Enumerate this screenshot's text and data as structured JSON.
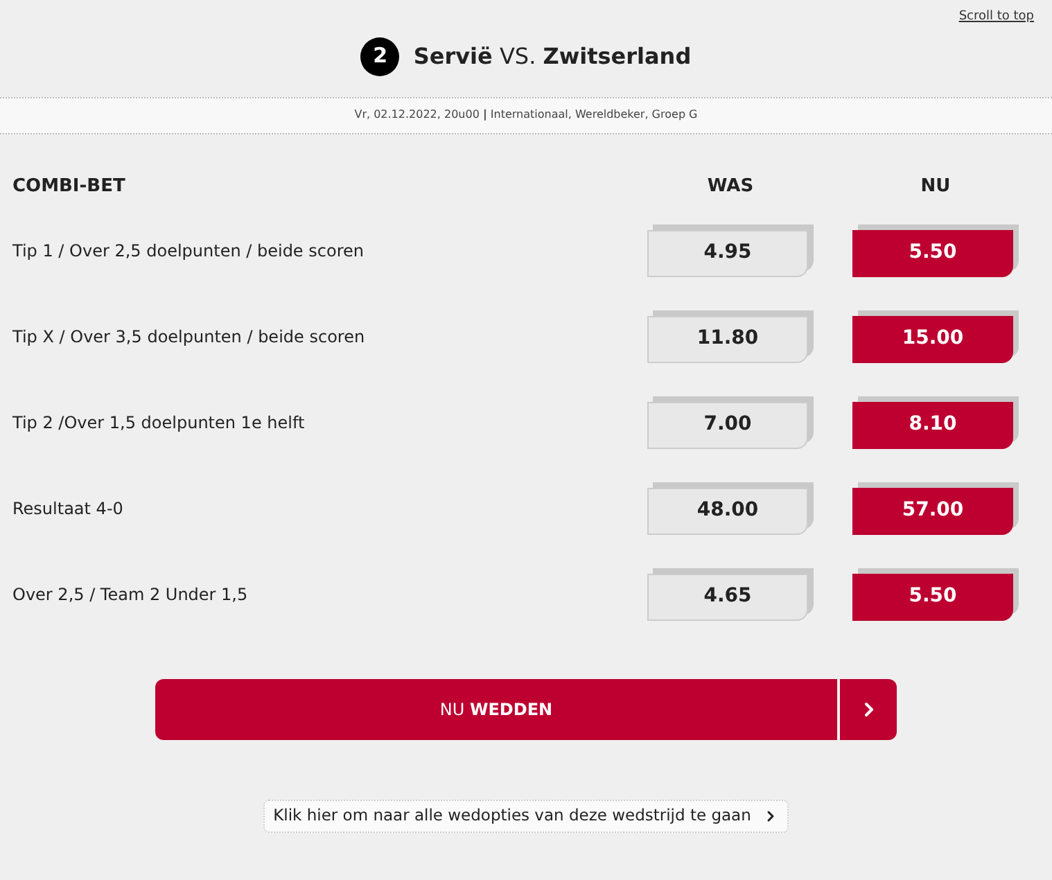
{
  "scroll_link": "Scroll to top",
  "match": {
    "number": "2",
    "title": "**Servië** VS. **Zwitserland**"
  },
  "meta": "Vr, 02.12.2022, 20u00 **|** Internationaal, Wereldbeker, Groep G",
  "table": {
    "columns": [
      "COMBI-BET",
      "WAS",
      "NU"
    ],
    "rows": [
      {
        "bet": "Tip 1 / Over 2,5 doelpunten / beide scoren",
        "was": "4.95",
        "nu": "5.50"
      },
      {
        "bet": "Tip X / Over 3,5 doelpunten / beide scoren",
        "was": "11.80",
        "nu": "15.00"
      },
      {
        "bet": "Tip 2 /Over 1,5 doelpunten 1e helft",
        "was": "7.00",
        "nu": "8.10"
      },
      {
        "bet": "Resultaat 4-0",
        "was": "48.00",
        "nu": "57.00"
      },
      {
        "bet": "Over 2,5 / Team 2 Under 1,5",
        "was": "4.65",
        "nu": "5.50"
      }
    ]
  },
  "bet_button": "NU **WEDDEN**",
  "all_options_link": "Klik hier om naar alle wedopties van deze wedstrijd te gaan"
}
